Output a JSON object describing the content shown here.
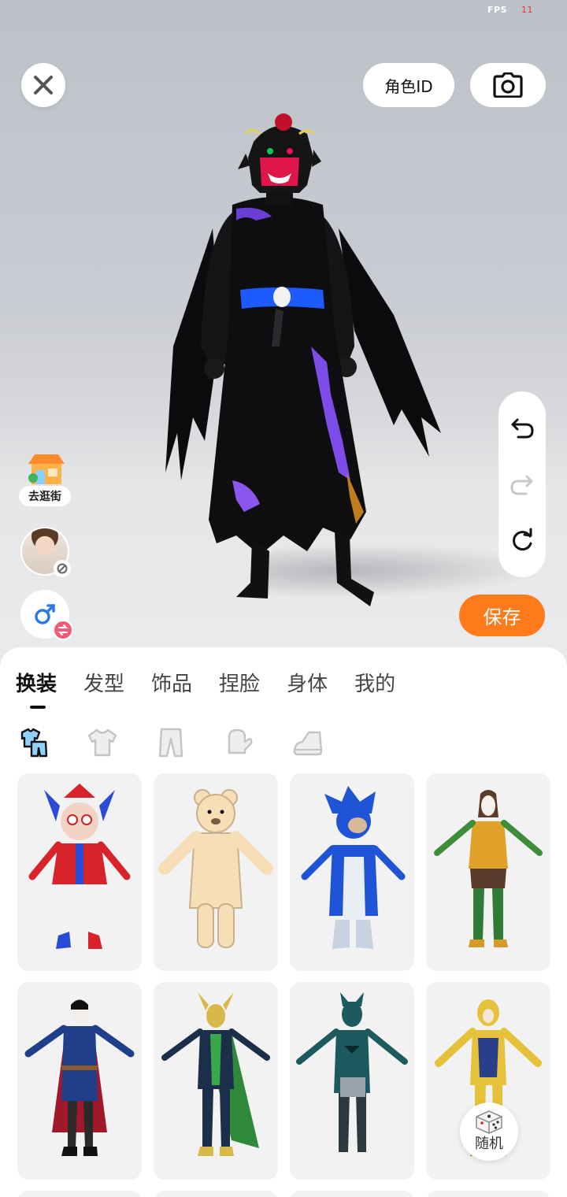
{
  "status": {
    "fps_label": "FPS",
    "fps_value": "11"
  },
  "header": {
    "role_id_label": "角色ID"
  },
  "side": {
    "go_street_label": "去逛街"
  },
  "actions": {
    "save_label": "保存",
    "random_label": "随机"
  },
  "tabs": [
    {
      "label": "换装",
      "active": true
    },
    {
      "label": "发型",
      "active": false
    },
    {
      "label": "饰品",
      "active": false
    },
    {
      "label": "捏脸",
      "active": false
    },
    {
      "label": "身体",
      "active": false
    },
    {
      "label": "我的",
      "active": false
    }
  ],
  "subcategories": [
    {
      "icon": "outfit-set-icon",
      "active": true
    },
    {
      "icon": "top-icon",
      "active": false
    },
    {
      "icon": "pants-icon",
      "active": false
    },
    {
      "icon": "glove-icon",
      "active": false
    },
    {
      "icon": "shoe-icon",
      "active": false
    }
  ],
  "outfits": [
    {
      "icon": "jester-costume-icon"
    },
    {
      "icon": "bear-costume-icon"
    },
    {
      "icon": "blue-hedgehog-costume-icon"
    },
    {
      "icon": "sea-hero-costume-icon"
    },
    {
      "icon": "sorcerer-costume-icon"
    },
    {
      "icon": "horned-trickster-costume-icon"
    },
    {
      "icon": "teal-bat-costume-icon"
    },
    {
      "icon": "gold-armor-costume-icon"
    }
  ],
  "colors": {
    "accent": "#ff7a1a",
    "swap_badge": "#f25a7a",
    "gender_male": "#2d7be0"
  }
}
